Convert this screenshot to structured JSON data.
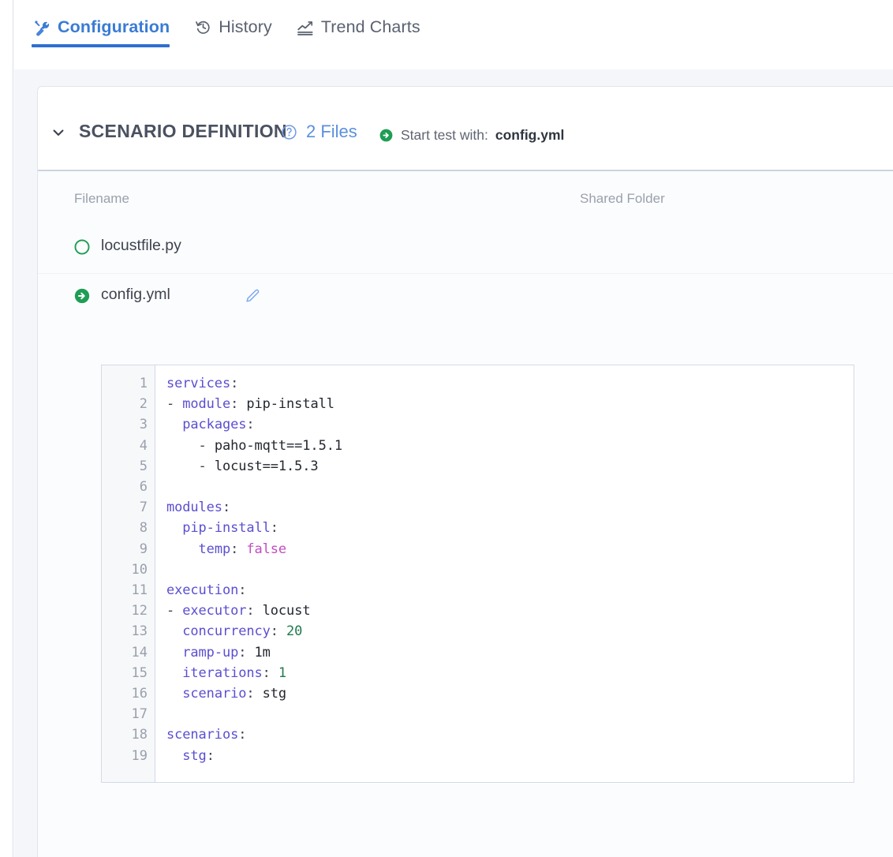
{
  "tabs": [
    {
      "id": "configuration",
      "label": "Configuration",
      "icon": "tools-icon",
      "active": true
    },
    {
      "id": "history",
      "label": "History",
      "icon": "history-clock-icon",
      "active": false
    },
    {
      "id": "trend-charts",
      "label": "Trend Charts",
      "icon": "line-chart-icon",
      "active": false
    }
  ],
  "section": {
    "toggle_icon": "chevron-down-icon",
    "title": "SCENARIO DEFINITION",
    "help_icon": "question-circle-icon",
    "files_count": "2 Files",
    "start_test": {
      "icon": "arrow-circle-right-icon",
      "label": "Start test with:",
      "file": "config.yml"
    }
  },
  "table": {
    "columns": [
      "Filename",
      "Shared Folder"
    ],
    "rows": [
      {
        "status_icon": "circle-outline-icon",
        "status_color": "#1f9d55",
        "filename": "locustfile.py",
        "shared_folder": "",
        "editable": false
      },
      {
        "status_icon": "arrow-circle-right-icon",
        "status_color": "#1f9d55",
        "filename": "config.yml",
        "shared_folder": "",
        "editable": true,
        "edit_icon": "pencil-edit-icon"
      }
    ]
  },
  "editor": {
    "filename": "config.yml",
    "first_line": 1,
    "line_numbers": [
      1,
      2,
      3,
      4,
      5,
      6,
      7,
      8,
      9,
      10,
      11,
      12,
      13,
      14,
      15,
      16,
      17,
      18,
      19
    ],
    "lines": [
      [
        {
          "t": "services",
          "c": "k"
        },
        {
          "t": ":",
          "c": "p"
        }
      ],
      [
        {
          "t": "- ",
          "c": "p"
        },
        {
          "t": "module",
          "c": "k"
        },
        {
          "t": ": ",
          "c": "p"
        },
        {
          "t": "pip-install",
          "c": "v"
        }
      ],
      [
        {
          "t": "  ",
          "c": "p"
        },
        {
          "t": "packages",
          "c": "k"
        },
        {
          "t": ":",
          "c": "p"
        }
      ],
      [
        {
          "t": "    - ",
          "c": "p"
        },
        {
          "t": "paho-mqtt==1.5.1",
          "c": "v"
        }
      ],
      [
        {
          "t": "    - ",
          "c": "p"
        },
        {
          "t": "locust==1.5.3",
          "c": "v"
        }
      ],
      [],
      [
        {
          "t": "modules",
          "c": "k"
        },
        {
          "t": ":",
          "c": "p"
        }
      ],
      [
        {
          "t": "  ",
          "c": "p"
        },
        {
          "t": "pip-install",
          "c": "k"
        },
        {
          "t": ":",
          "c": "p"
        }
      ],
      [
        {
          "t": "    ",
          "c": "p"
        },
        {
          "t": "temp",
          "c": "k"
        },
        {
          "t": ": ",
          "c": "p"
        },
        {
          "t": "false",
          "c": "b"
        }
      ],
      [],
      [
        {
          "t": "execution",
          "c": "k"
        },
        {
          "t": ":",
          "c": "p"
        }
      ],
      [
        {
          "t": "- ",
          "c": "p"
        },
        {
          "t": "executor",
          "c": "k"
        },
        {
          "t": ": ",
          "c": "p"
        },
        {
          "t": "locust",
          "c": "v"
        }
      ],
      [
        {
          "t": "  ",
          "c": "p"
        },
        {
          "t": "concurrency",
          "c": "k"
        },
        {
          "t": ": ",
          "c": "p"
        },
        {
          "t": "20",
          "c": "n"
        }
      ],
      [
        {
          "t": "  ",
          "c": "p"
        },
        {
          "t": "ramp-up",
          "c": "k"
        },
        {
          "t": ": ",
          "c": "p"
        },
        {
          "t": "1m",
          "c": "v"
        }
      ],
      [
        {
          "t": "  ",
          "c": "p"
        },
        {
          "t": "iterations",
          "c": "k"
        },
        {
          "t": ": ",
          "c": "p"
        },
        {
          "t": "1",
          "c": "n"
        }
      ],
      [
        {
          "t": "  ",
          "c": "p"
        },
        {
          "t": "scenario",
          "c": "k"
        },
        {
          "t": ": ",
          "c": "p"
        },
        {
          "t": "stg",
          "c": "v"
        }
      ],
      [],
      [
        {
          "t": "scenarios",
          "c": "k"
        },
        {
          "t": ":",
          "c": "p"
        }
      ],
      [
        {
          "t": "  ",
          "c": "p"
        },
        {
          "t": "stg",
          "c": "k"
        },
        {
          "t": ":",
          "c": "p"
        }
      ]
    ],
    "raw_text": "services:\n- module: pip-install\n  packages:\n    - paho-mqtt==1.5.1\n    - locust==1.5.3\n\nmodules:\n  pip-install:\n    temp: false\n\nexecution:\n- executor: locust\n  concurrency: 20\n  ramp-up: 1m\n  iterations: 1\n  scenario: stg\n\nscenarios:\n  stg:"
  },
  "colors": {
    "accent_blue": "#2f6fd0",
    "tab_active_text": "#3a7bd5",
    "link_blue": "#5b8fe0",
    "green": "#1f9d55",
    "yaml_key": "#5b4fd0",
    "yaml_bool": "#c34cc3",
    "yaml_number": "#1f7a4d",
    "page_bg": "#f4f6fa"
  }
}
